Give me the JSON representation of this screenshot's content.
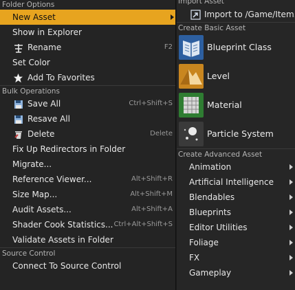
{
  "left_menu": {
    "folder_options_header": "Folder Options",
    "items_folder": [
      {
        "label": "New Asset"
      },
      {
        "label": "Show in Explorer"
      },
      {
        "label": "Rename",
        "shortcut": "F2"
      },
      {
        "label": "Set Color"
      },
      {
        "label": "Add To Favorites"
      }
    ],
    "bulk_operations_header": "Bulk Operations",
    "items_bulk": [
      {
        "label": "Save All",
        "shortcut": "Ctrl+Shift+S"
      },
      {
        "label": "Resave All"
      },
      {
        "label": "Delete",
        "shortcut": "Delete"
      },
      {
        "label": "Fix Up Redirectors in Folder"
      },
      {
        "label": "Migrate..."
      },
      {
        "label": "Reference Viewer...",
        "shortcut": "Alt+Shift+R"
      },
      {
        "label": "Size Map...",
        "shortcut": "Alt+Shift+M"
      },
      {
        "label": "Audit Assets...",
        "shortcut": "Alt+Shift+A"
      },
      {
        "label": "Shader Cook Statistics...",
        "shortcut": "Ctrl+Alt+Shift+S"
      },
      {
        "label": "Validate Assets in Folder"
      }
    ],
    "source_control_header": "Source Control",
    "items_source": [
      {
        "label": "Connect To Source Control"
      }
    ]
  },
  "right_menu": {
    "import_header": "Import Asset",
    "import_item": "Import to /Game/Item...",
    "basic_header": "Create Basic Asset",
    "basic_items": [
      {
        "label": "Blueprint Class"
      },
      {
        "label": "Level"
      },
      {
        "label": "Material"
      },
      {
        "label": "Particle System"
      }
    ],
    "advanced_header": "Create Advanced Asset",
    "advanced_items": [
      {
        "label": "Animation"
      },
      {
        "label": "Artificial Intelligence"
      },
      {
        "label": "Blendables"
      },
      {
        "label": "Blueprints"
      },
      {
        "label": "Editor Utilities"
      },
      {
        "label": "Foliage"
      },
      {
        "label": "FX"
      },
      {
        "label": "Gameplay"
      }
    ]
  },
  "colors": {
    "highlight": "#e7a41f",
    "menu_bg": "#242424"
  }
}
